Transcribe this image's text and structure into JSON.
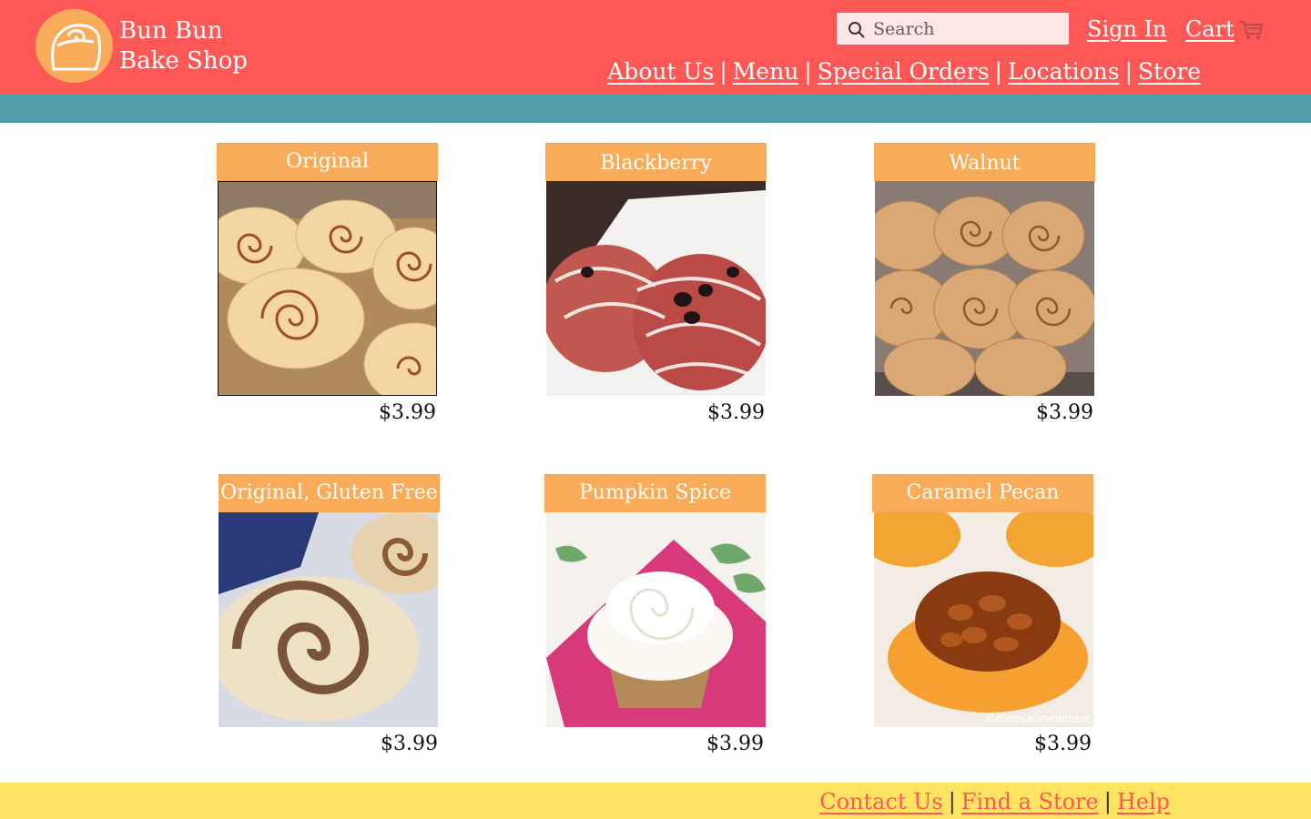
{
  "brand": {
    "line1": "Bun Bun",
    "line2": "Bake Shop"
  },
  "search": {
    "placeholder": "Search"
  },
  "header_links": {
    "sign_in": "Sign In",
    "cart": "Cart"
  },
  "nav": [
    {
      "label": "About Us"
    },
    {
      "label": "Menu"
    },
    {
      "label": "Special Orders"
    },
    {
      "label": "Locations"
    },
    {
      "label": "Store"
    }
  ],
  "nav_separator": "|",
  "products": [
    {
      "name": "Original",
      "price": "$3.99"
    },
    {
      "name": "Blackberry",
      "price": "$3.99"
    },
    {
      "name": "Walnut",
      "price": "$3.99"
    },
    {
      "name": "Original, Gluten Free",
      "price": "$3.99"
    },
    {
      "name": "Pumpkin Spice",
      "price": "$3.99"
    },
    {
      "name": "Caramel Pecan",
      "price": "$3.99"
    }
  ],
  "photo_watermark": "©dinosaurscanteat",
  "footer": [
    {
      "label": "Contact Us"
    },
    {
      "label": "Find a Store"
    },
    {
      "label": "Help"
    }
  ],
  "colors": {
    "header": "#fd5756",
    "accent_orange": "#f8ac5a",
    "teal_band": "#509ea9",
    "footer": "#ffe464"
  }
}
